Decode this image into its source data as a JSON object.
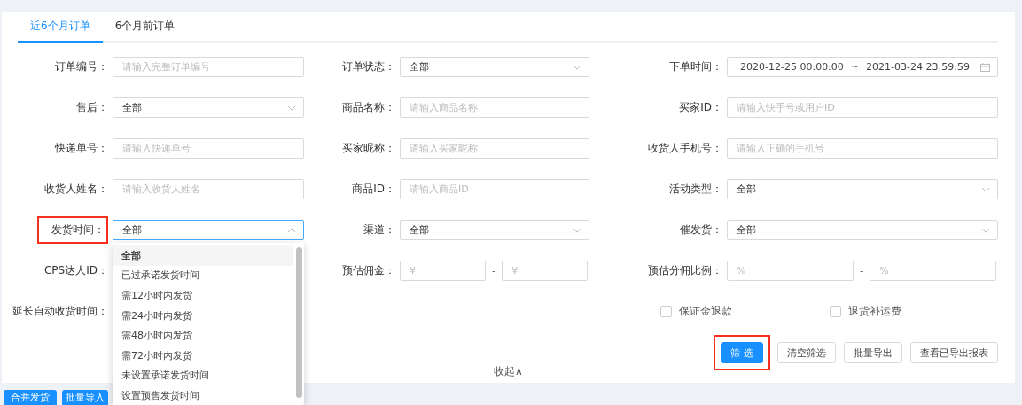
{
  "tabs": [
    {
      "label": "近6个月订单",
      "selected": true
    },
    {
      "label": "6个月前订单",
      "selected": false
    }
  ],
  "filters": [
    {
      "kind": "text",
      "label": "订单编号：",
      "placeholder": "请输入完整订单编号",
      "highlighted": false
    },
    {
      "kind": "select",
      "label": "订单状态：",
      "value": "全部",
      "highlighted": false,
      "open": false
    },
    {
      "kind": "date_range",
      "label": "下单时间：",
      "start": "2020-12-25 00:00:00",
      "separator": "~",
      "end": "2021-03-24 23:59:59",
      "highlighted": false
    },
    {
      "kind": "select",
      "label": "售后：",
      "value": "全部",
      "highlighted": false,
      "open": false
    },
    {
      "kind": "text",
      "label": "商品名称：",
      "placeholder": "请输入商品名称",
      "highlighted": false
    },
    {
      "kind": "text",
      "label": "买家ID：",
      "placeholder": "请输入快手号或用户ID",
      "highlighted": false
    },
    {
      "kind": "text",
      "label": "快递单号：",
      "placeholder": "请输入快递单号",
      "highlighted": false
    },
    {
      "kind": "text",
      "label": "买家昵称：",
      "placeholder": "请输入买家昵称",
      "highlighted": false
    },
    {
      "kind": "text",
      "label": "收货人手机号：",
      "placeholder": "请输入正确的手机号",
      "highlighted": false
    },
    {
      "kind": "text",
      "label": "收货人姓名：",
      "placeholder": "请输入收货人姓名",
      "highlighted": false
    },
    {
      "kind": "text",
      "label": "商品ID：",
      "placeholder": "请输入商品ID",
      "highlighted": false
    },
    {
      "kind": "select",
      "label": "活动类型：",
      "value": "全部",
      "highlighted": false,
      "open": false
    },
    {
      "kind": "select",
      "label": "发货时间：",
      "value": "全部",
      "highlighted": true,
      "open": true
    },
    {
      "kind": "select",
      "label": "渠道：",
      "value": "全部",
      "highlighted": false,
      "open": false
    },
    {
      "kind": "select",
      "label": "催发货：",
      "value": "全部",
      "highlighted": false,
      "open": false
    },
    {
      "kind": "covered",
      "label": "CPS达人ID：",
      "highlighted": false
    },
    {
      "kind": "range",
      "label": "预估佣金：",
      "from": {
        "placeholder": "¥"
      },
      "separator": "-",
      "to": {
        "placeholder": "¥"
      },
      "highlighted": false
    },
    {
      "kind": "range",
      "label": "预估分佣比例：",
      "from": {
        "placeholder": "%"
      },
      "separator": "-",
      "to": {
        "placeholder": "%"
      },
      "highlighted": false
    },
    {
      "kind": "covered",
      "label": "延长自动收货时间：",
      "highlighted": false
    }
  ],
  "checkboxes": [
    {
      "label": "保证金退款",
      "checked": false
    },
    {
      "label": "退货补运费",
      "checked": false
    }
  ],
  "actions": [
    {
      "label": "筛 选",
      "primary": true,
      "highlighted": true
    },
    {
      "label": "清空筛选",
      "primary": false,
      "highlighted": false
    },
    {
      "label": "批量导出",
      "primary": false,
      "highlighted": false
    },
    {
      "label": "查看已导出报表",
      "primary": false,
      "highlighted": false
    }
  ],
  "collapse": {
    "label": "收起",
    "arrow": "∧"
  },
  "dropdown_options": [
    {
      "label": "全部",
      "selected": true
    },
    {
      "label": "已过承诺发货时间",
      "selected": false
    },
    {
      "label": "需12小时内发货",
      "selected": false
    },
    {
      "label": "需24小时内发货",
      "selected": false
    },
    {
      "label": "需48小时内发货",
      "selected": false
    },
    {
      "label": "需72小时内发货",
      "selected": false
    },
    {
      "label": "未设置承诺发货时间",
      "selected": false
    },
    {
      "label": "设置预售发货时间",
      "selected": false
    }
  ],
  "bottom_buttons": [
    "合并发货",
    "批量导入"
  ]
}
